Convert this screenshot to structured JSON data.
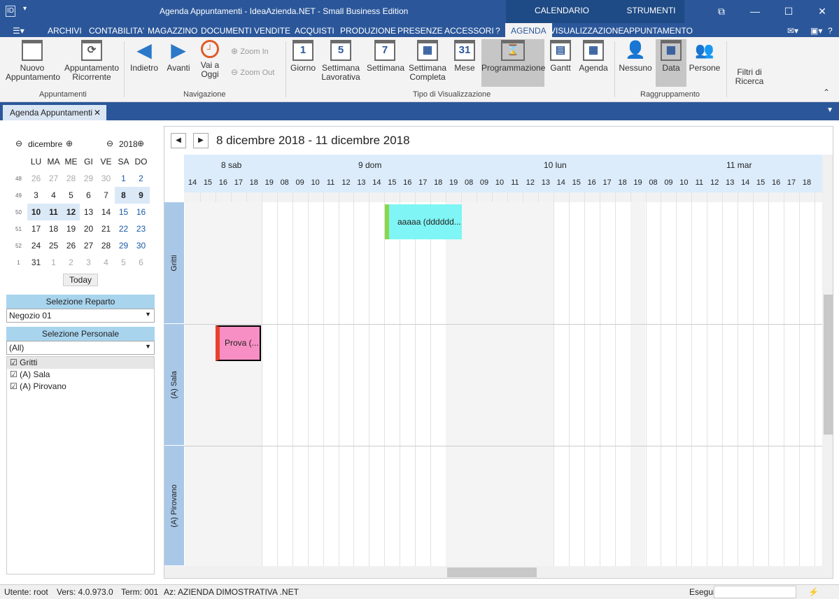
{
  "window": {
    "title": "Agenda Appuntamenti - IdeaAzienda.NET - Small Business Edition",
    "ctx1": "CALENDARIO",
    "ctx2": "STRUMENTI CALE"
  },
  "menu": [
    "ARCHIVI",
    "CONTABILITA'",
    "MAGAZZINO",
    "DOCUMENTI",
    "VENDITE",
    "ACQUISTI",
    "PRODUZIONE",
    "PRESENZE",
    "ACCESSORI",
    "?",
    "AGENDA",
    "VISUALIZZAZIONE",
    "APPUNTAMENTO"
  ],
  "ribbon": {
    "nuovo": "Nuovo Appuntamento",
    "ricorrente": "Appuntamento Ricorrente",
    "indietro": "Indietro",
    "avanti": "Avanti",
    "oggi": "Vai a Oggi",
    "zoomin": "Zoom In",
    "zoomout": "Zoom Out",
    "giorno": "Giorno",
    "settlav": "Settimana Lavorativa",
    "sett": "Settimana",
    "settcomp": "Settimana Completa",
    "mese": "Mese",
    "progr": "Programmazione",
    "gantt": "Gantt",
    "agenda": "Agenda",
    "nessuno": "Nessuno",
    "data": "Data",
    "persone": "Persone",
    "filtri": "Filtri di Ricerca",
    "g1": "Appuntamenti",
    "g2": "Navigazione",
    "g3": "Tipo di Visualizzazione",
    "g4": "Raggruppamento"
  },
  "tab": {
    "label": "Agenda Appuntamenti"
  },
  "mini": {
    "month": "dicembre",
    "year": "2018",
    "days": [
      "LU",
      "MA",
      "ME",
      "GI",
      "VE",
      "SA",
      "DO"
    ],
    "weeks": [
      [
        "48",
        "26",
        "27",
        "28",
        "29",
        "30",
        "1",
        "2"
      ],
      [
        "49",
        "3",
        "4",
        "5",
        "6",
        "7",
        "8",
        "9"
      ],
      [
        "50",
        "10",
        "11",
        "12",
        "13",
        "14",
        "15",
        "16"
      ],
      [
        "51",
        "17",
        "18",
        "19",
        "20",
        "21",
        "22",
        "23"
      ],
      [
        "52",
        "24",
        "25",
        "26",
        "27",
        "28",
        "29",
        "30"
      ],
      [
        "1",
        "31",
        "1",
        "2",
        "3",
        "4",
        "5",
        "6"
      ]
    ],
    "today": "Today"
  },
  "reparto": {
    "title": "Selezione Reparto",
    "value": "Negozio 01"
  },
  "personale": {
    "title": "Selezione Personale",
    "value": "(All)",
    "items": [
      "Gritti",
      "(A) Sala",
      "(A) Pirovano"
    ]
  },
  "sched": {
    "range": "8 dicembre 2018 - 11 dicembre 2018",
    "days": [
      "8 sab",
      "9 dom",
      "10 lun",
      "11 mar"
    ],
    "hours": [
      "14",
      "15",
      "16",
      "17",
      "18",
      "19",
      "08",
      "09",
      "10",
      "11",
      "12",
      "13",
      "14",
      "15",
      "16",
      "17",
      "18",
      "19",
      "08",
      "09",
      "10",
      "11",
      "12",
      "13",
      "14",
      "15",
      "16",
      "17",
      "18",
      "19",
      "08",
      "09",
      "10",
      "11",
      "12",
      "13",
      "14",
      "15",
      "16",
      "17",
      "18"
    ],
    "resources": [
      "Gritti",
      "(A) Sala",
      "(A) Pirovano"
    ],
    "appt1": "aaaaa (dddddd...",
    "appt2": "Prova (...",
    "colors": {
      "appt1": "#7ff5f5",
      "appt2": "#f78fc4"
    }
  },
  "status": {
    "user": "Utente: root",
    "vers": "Vers: 4.0.973.0",
    "term": "Term: 001",
    "az": "Az: AZIENDA DIMOSTRATIVA .NET",
    "esegui": "Esegui"
  }
}
